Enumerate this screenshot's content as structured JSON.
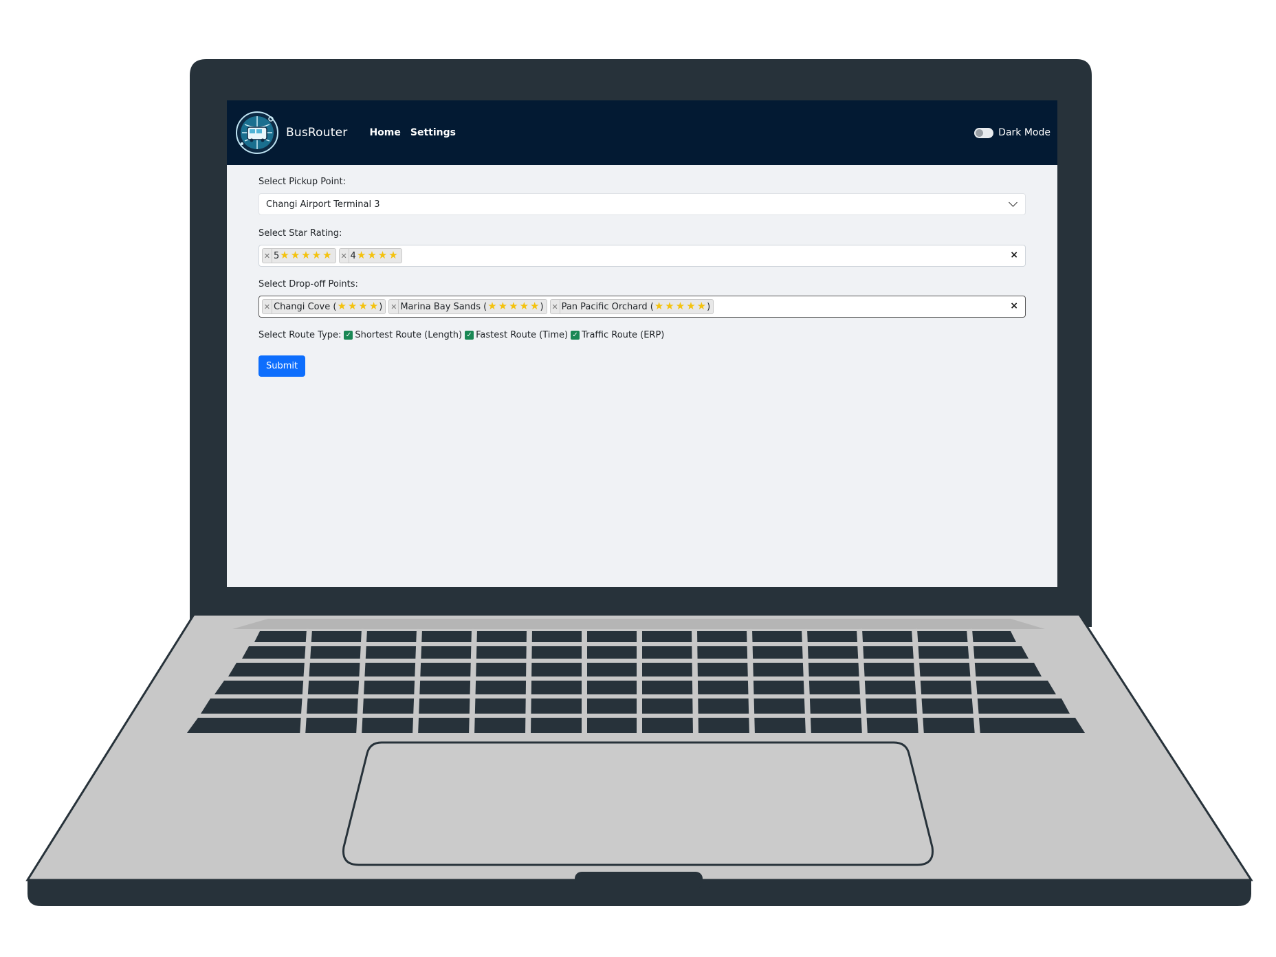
{
  "navbar": {
    "brand": "BusRouter",
    "links": [
      "Home",
      "Settings"
    ],
    "dark_mode_label": "Dark Mode",
    "dark_mode_on": false,
    "background": "#031a33"
  },
  "form": {
    "pickup": {
      "label": "Select Pickup Point:",
      "value": "Changi Airport Terminal 3"
    },
    "star_rating": {
      "label": "Select Star Rating:",
      "tags": [
        {
          "text": "5",
          "stars": 5
        },
        {
          "text": "4",
          "stars": 4
        }
      ],
      "clear": "×"
    },
    "dropoff": {
      "label": "Select Drop-off Points:",
      "tags": [
        {
          "text": "Changi Cove (",
          "stars": 4,
          "suffix": ")"
        },
        {
          "text": "Marina Bay Sands (",
          "stars": 5,
          "suffix": ")"
        },
        {
          "text": "Pan Pacific Orchard (",
          "stars": 5,
          "suffix": ")"
        }
      ],
      "clear": "×"
    },
    "route_type": {
      "label": "Select Route Type:",
      "options": [
        {
          "label": "Shortest Route (Length)",
          "checked": true
        },
        {
          "label": "Fastest Route (Time)",
          "checked": true
        },
        {
          "label": "Traffic Route (ERP)",
          "checked": true
        }
      ]
    },
    "submit_label": "Submit"
  },
  "colors": {
    "primary": "#0d6efd",
    "checkbox": "#198754",
    "star": "#f4c20d",
    "page_bg": "#f0f2f5"
  }
}
